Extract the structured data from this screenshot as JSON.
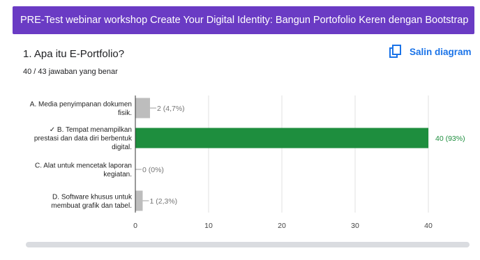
{
  "header": {
    "title": "PRE-Test webinar workshop  Create Your Digital Identity: Bangun Portofolio Keren dengan Bootstrap"
  },
  "question": {
    "title": "1. Apa itu E-Portfolio?",
    "score": "40 / 43 jawaban yang benar"
  },
  "copy_button": {
    "label": "Salin diagram",
    "icon": "copy-icon"
  },
  "colors": {
    "header_bg": "#6a3bc4",
    "correct_bar": "#1e8e3e",
    "other_bar": "#bdbdbd",
    "link": "#1a73e8"
  },
  "chart_data": {
    "type": "bar",
    "orientation": "horizontal",
    "categories": [
      [
        "A. Media penyimpanan dokumen",
        "fisik."
      ],
      [
        "✓ B. Tempat menampilkan",
        "prestasi dan data diri berbentuk",
        "digital."
      ],
      [
        "C. Alat untuk mencetak laporan",
        "kegiatan."
      ],
      [
        "D. Software khusus untuk",
        "membuat grafik dan tabel."
      ]
    ],
    "values": [
      2,
      40,
      0,
      1
    ],
    "value_labels": [
      "2 (4,7%)",
      "40 (93%)",
      "0 (0%)",
      "1 (2,3%)"
    ],
    "correct": [
      false,
      true,
      false,
      false
    ],
    "xlim": [
      0,
      40
    ],
    "xticks": [
      0,
      10,
      20,
      30,
      40
    ],
    "grid": true
  }
}
